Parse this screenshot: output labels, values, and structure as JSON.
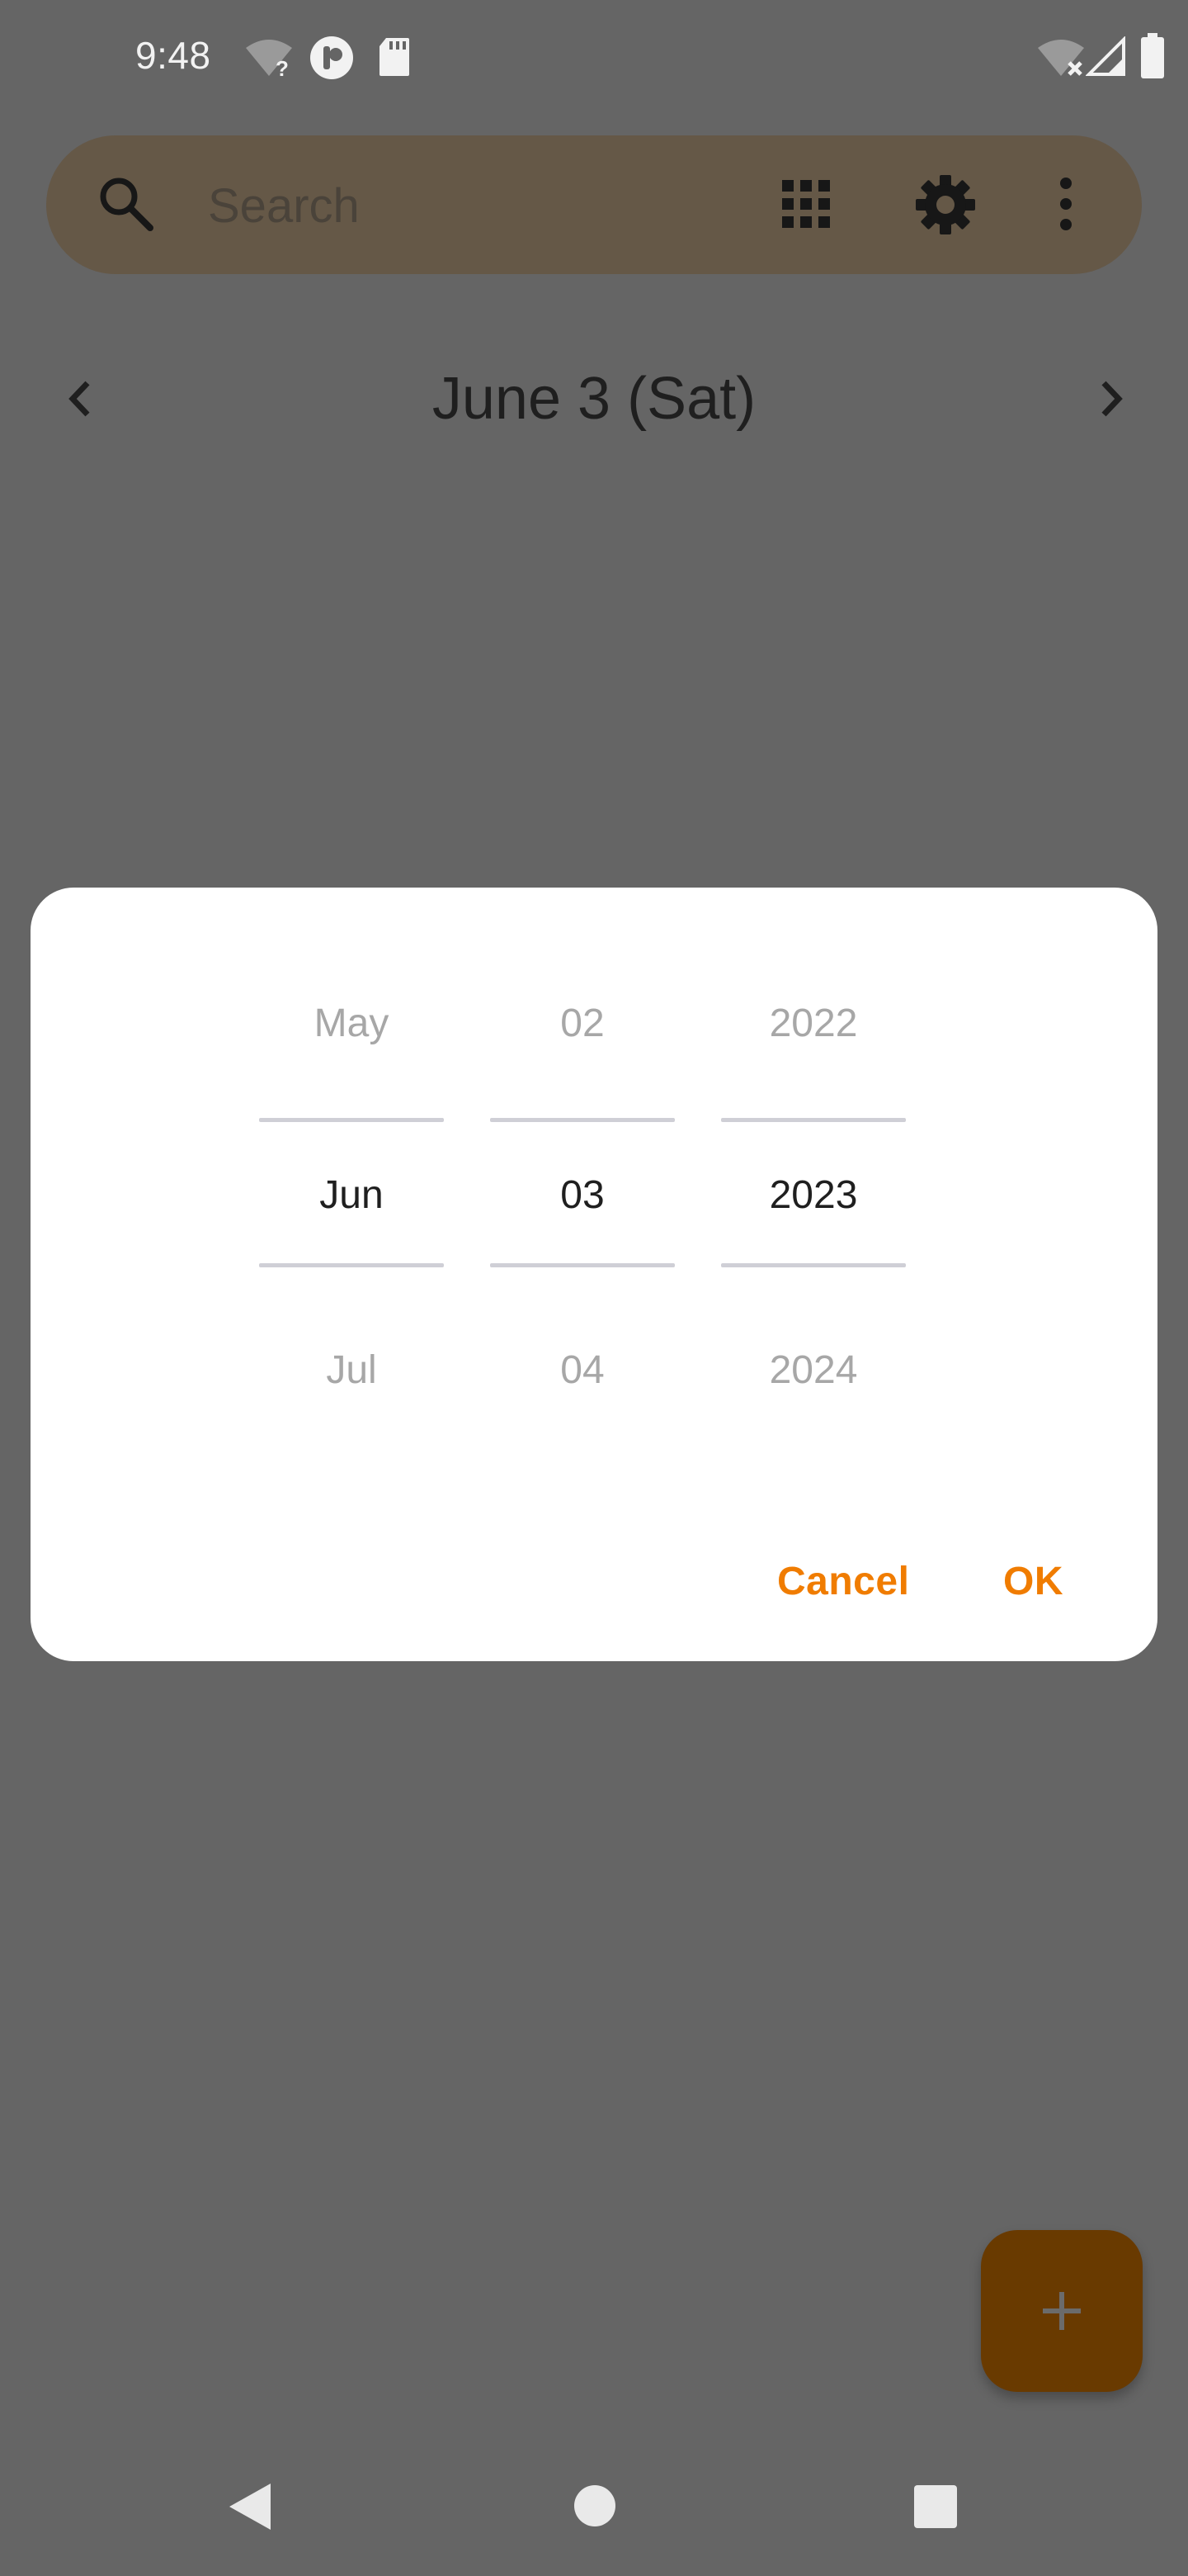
{
  "status_bar": {
    "time": "9:48",
    "icons_left": [
      "wifi-unknown-icon",
      "app-notification-icon",
      "sd-card-icon"
    ],
    "icons_right": [
      "wifi-off-icon",
      "cell-signal-icon",
      "battery-icon"
    ]
  },
  "search": {
    "placeholder": "Search",
    "icons": [
      "search-icon",
      "grid-icon",
      "gear-icon",
      "more-vert-icon"
    ]
  },
  "date_nav": {
    "title": "June 3 (Sat)",
    "prev_icon": "chevron-left-icon",
    "next_icon": "chevron-right-icon"
  },
  "date_picker": {
    "month": {
      "prev": "May",
      "selected": "Jun",
      "next": "Jul"
    },
    "day": {
      "prev": "02",
      "selected": "03",
      "next": "04"
    },
    "year": {
      "prev": "2022",
      "selected": "2023",
      "next": "2024"
    },
    "cancel_label": "Cancel",
    "ok_label": "OK"
  },
  "fab": {
    "icon": "plus-icon"
  },
  "nav_bar": {
    "icons": [
      "back-icon",
      "home-icon",
      "recents-icon"
    ]
  },
  "colors": {
    "scrim": "#656565",
    "accent": "#f07c00",
    "fab": "#693a00",
    "searchbar": "#655847"
  }
}
